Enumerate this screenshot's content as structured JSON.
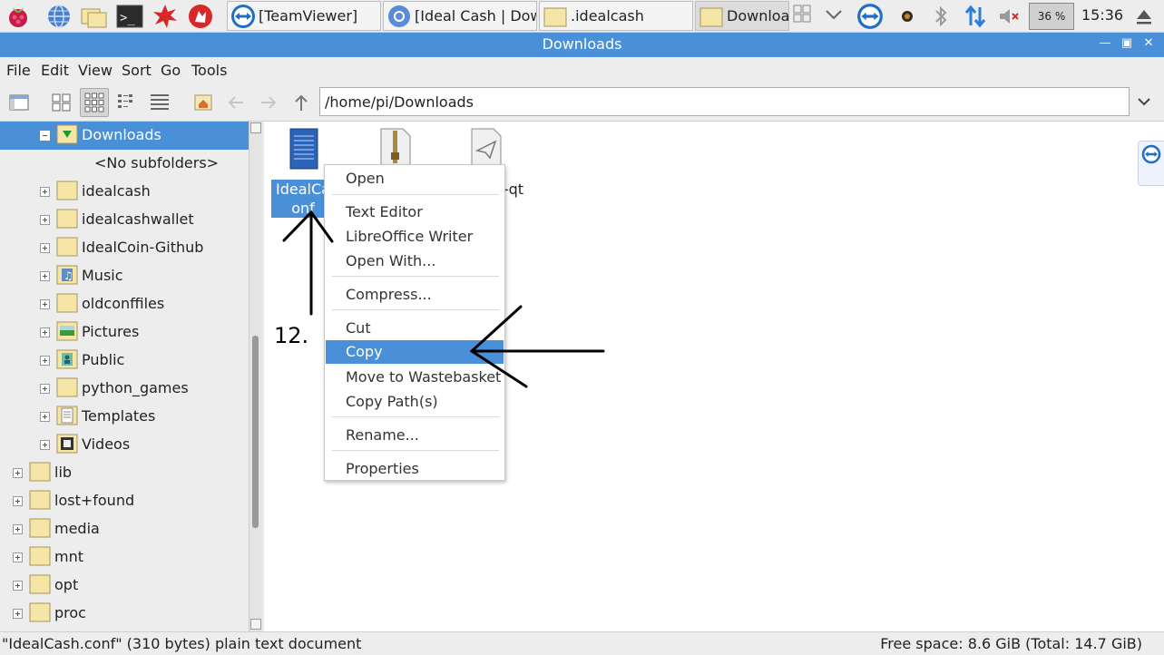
{
  "taskbar": {
    "tasks": [
      {
        "label": "[TeamViewer]"
      },
      {
        "label": "[Ideal Cash | Dow..."
      },
      {
        "label": ".idealcash"
      },
      {
        "label": "Downloads"
      }
    ],
    "battery": "36 %",
    "clock": "15:36"
  },
  "window": {
    "title": "Downloads"
  },
  "menu": {
    "items": [
      "File",
      "Edit",
      "View",
      "Sort",
      "Go",
      "Tools"
    ]
  },
  "toolbar": {
    "path": "/home/pi/Downloads"
  },
  "sidebar": {
    "items": [
      {
        "label": "Downloads"
      },
      {
        "label": "<No subfolders>"
      },
      {
        "label": "idealcash"
      },
      {
        "label": "idealcashwallet"
      },
      {
        "label": "IdealCoin-Github"
      },
      {
        "label": "Music"
      },
      {
        "label": "oldconffiles"
      },
      {
        "label": "Pictures"
      },
      {
        "label": "Public"
      },
      {
        "label": "python_games"
      },
      {
        "label": "Templates"
      },
      {
        "label": "Videos"
      },
      {
        "label": "lib"
      },
      {
        "label": "lost+found"
      },
      {
        "label": "media"
      },
      {
        "label": "mnt"
      },
      {
        "label": "opt"
      },
      {
        "label": "proc"
      }
    ]
  },
  "files": {
    "items": [
      {
        "name_line1": "IdealCa",
        "name_line2": "onf",
        "icon": "text-file-icon"
      },
      {
        "name_line1": "",
        "name_line2": "",
        "icon": "archive-file-icon"
      },
      {
        "name_line1": "-qt",
        "name_line2": "",
        "icon": "executable-file-icon"
      }
    ]
  },
  "context_menu": {
    "items": [
      "Open",
      "Text Editor",
      "LibreOffice Writer",
      "Open With...",
      "Compress...",
      "Cut",
      "Copy",
      "Move to Wastebasket",
      "Copy Path(s)",
      "Rename...",
      "Properties"
    ],
    "highlighted": "Copy"
  },
  "annotation": {
    "step": "12."
  },
  "statusbar": {
    "left": "\"IdealCash.conf\" (310 bytes) plain text document",
    "right": "Free space: 8.6 GiB (Total: 14.7 GiB)"
  },
  "colors": {
    "accent": "#4a90d9",
    "folder": "#f5e6a8"
  }
}
